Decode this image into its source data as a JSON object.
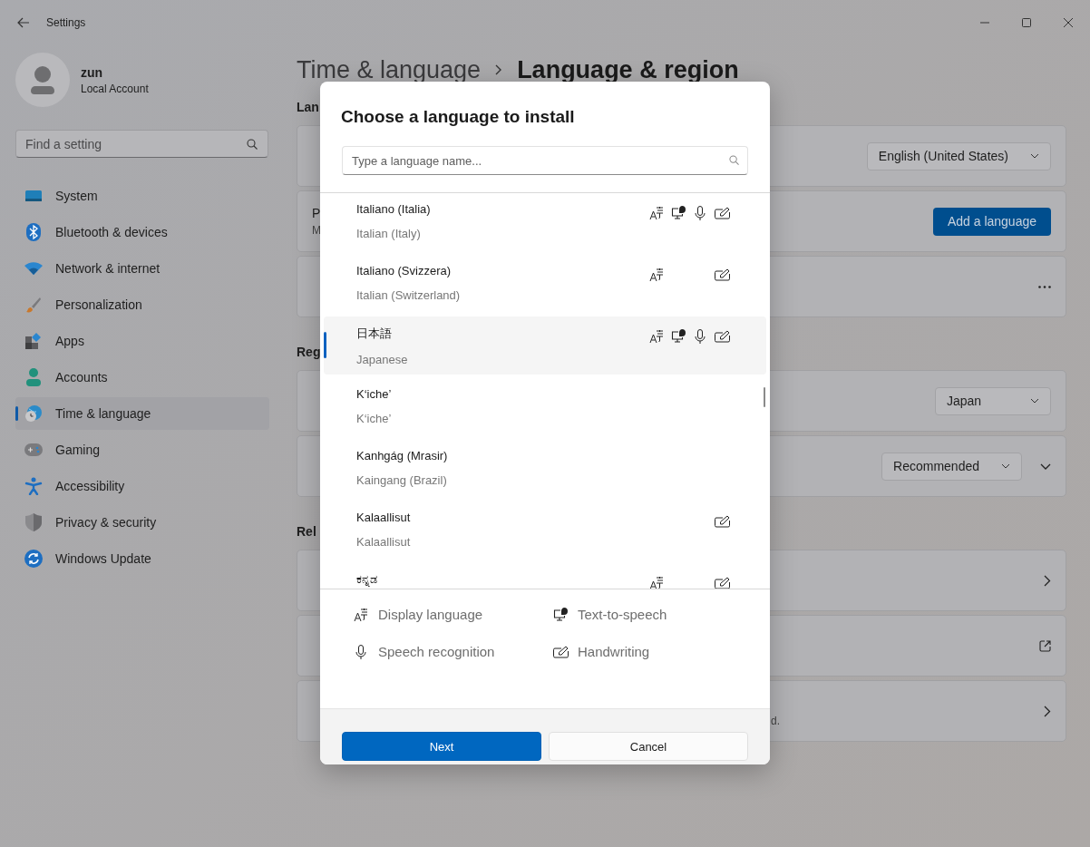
{
  "window": {
    "title": "Settings"
  },
  "account": {
    "name": "zun",
    "type": "Local Account"
  },
  "search": {
    "placeholder": "Find a setting"
  },
  "nav": [
    {
      "label": "System",
      "selected": false
    },
    {
      "label": "Bluetooth & devices",
      "selected": false
    },
    {
      "label": "Network & internet",
      "selected": false
    },
    {
      "label": "Personalization",
      "selected": false
    },
    {
      "label": "Apps",
      "selected": false
    },
    {
      "label": "Accounts",
      "selected": false
    },
    {
      "label": "Time & language",
      "selected": true
    },
    {
      "label": "Gaming",
      "selected": false
    },
    {
      "label": "Accessibility",
      "selected": false
    },
    {
      "label": "Privacy & security",
      "selected": false
    },
    {
      "label": "Windows Update",
      "selected": false
    }
  ],
  "breadcrumb": {
    "parent": "Time & language",
    "current": "Language & region"
  },
  "sections": [
    {
      "heading": "Lan",
      "cards": [
        {
          "kind": "dropdown",
          "value": "English (United States)"
        },
        {
          "kind": "button",
          "title_fragment": "P",
          "subtitle_fragment": "M",
          "label": "Add a language"
        },
        {
          "kind": "more"
        }
      ]
    },
    {
      "heading": "Reg",
      "cards": [
        {
          "kind": "dropdown",
          "value": "Japan"
        },
        {
          "kind": "dropdown",
          "value": "Recommended",
          "expandable": true
        }
      ]
    },
    {
      "heading": "Rel",
      "cards": [
        {
          "kind": "link"
        },
        {
          "kind": "external"
        },
        {
          "kind": "link",
          "text_fragment": "d."
        }
      ]
    }
  ],
  "dialog": {
    "title": "Choose a language to install",
    "search_placeholder": "Type a language name...",
    "languages": [
      {
        "name": "Italiano (Italia)",
        "english": "Italian (Italy)",
        "display": true,
        "tts": true,
        "speech": true,
        "handwriting": true,
        "selected": false
      },
      {
        "name": "Italiano (Svizzera)",
        "english": "Italian (Switzerland)",
        "display": true,
        "tts": false,
        "speech": false,
        "handwriting": true,
        "selected": false
      },
      {
        "name": "日本語",
        "english": "Japanese",
        "display": true,
        "tts": true,
        "speech": true,
        "handwriting": true,
        "selected": true
      },
      {
        "name": "K‘iche’",
        "english": "K‘iche’",
        "display": false,
        "tts": false,
        "speech": false,
        "handwriting": false,
        "selected": false
      },
      {
        "name": "Kanhgág (Mrasir)",
        "english": "Kaingang (Brazil)",
        "display": false,
        "tts": false,
        "speech": false,
        "handwriting": false,
        "selected": false
      },
      {
        "name": "Kalaallisut",
        "english": "Kalaallisut",
        "display": false,
        "tts": false,
        "speech": false,
        "handwriting": true,
        "selected": false
      },
      {
        "name": "ಕನ್ನಡ",
        "display": true,
        "tts": false,
        "speech": false,
        "handwriting": true,
        "selected": false
      }
    ],
    "legend": [
      {
        "kind": "display",
        "label": "Display language"
      },
      {
        "kind": "tts",
        "label": "Text-to-speech"
      },
      {
        "kind": "speech",
        "label": "Speech recognition"
      },
      {
        "kind": "handwriting",
        "label": "Handwriting"
      }
    ],
    "buttons": [
      {
        "label": "Next",
        "primary": true
      },
      {
        "label": "Cancel",
        "primary": false
      }
    ]
  }
}
